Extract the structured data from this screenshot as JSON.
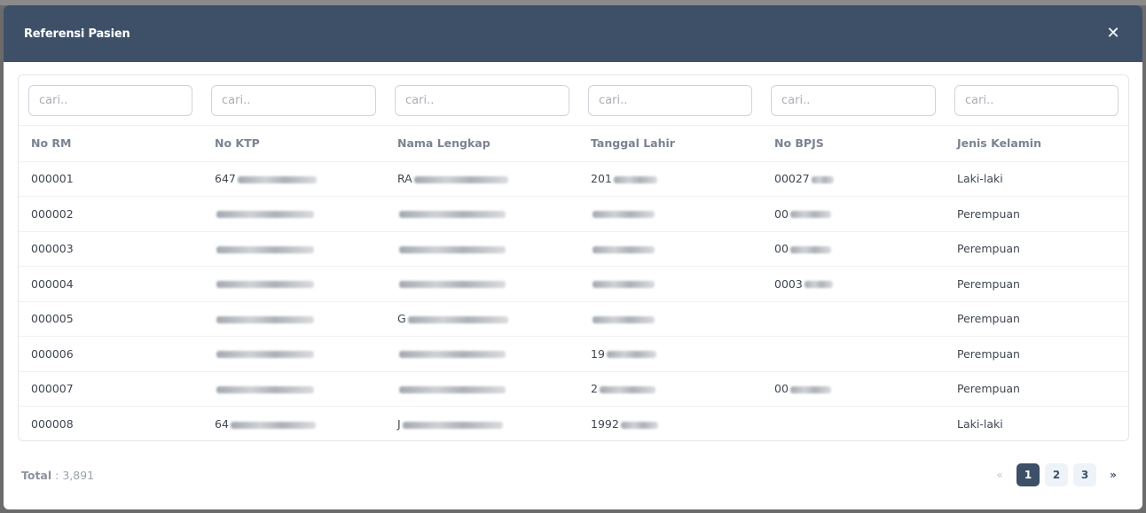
{
  "modal": {
    "title": "Referensi Pasien",
    "close_symbol": "✕"
  },
  "filters": [
    {
      "placeholder": "cari.."
    },
    {
      "placeholder": "cari.."
    },
    {
      "placeholder": "cari.."
    },
    {
      "placeholder": "cari.."
    },
    {
      "placeholder": "cari.."
    },
    {
      "placeholder": "cari.."
    }
  ],
  "table": {
    "columns": [
      "No RM",
      "No KTP",
      "Nama Lengkap",
      "Tanggal Lahir",
      "No BPJS",
      "Jenis Kelamin"
    ],
    "rows": [
      {
        "no_rm": "000001",
        "no_ktp": "647",
        "nama": "RA",
        "tgl": "201",
        "bpjs": "00027",
        "jk": "Laki-laki"
      },
      {
        "no_rm": "000002",
        "no_ktp": "",
        "nama": "",
        "tgl": "",
        "bpjs": "00",
        "jk": "Perempuan"
      },
      {
        "no_rm": "000003",
        "no_ktp": "",
        "nama": "",
        "tgl": "",
        "bpjs": "00",
        "jk": "Perempuan"
      },
      {
        "no_rm": "000004",
        "no_ktp": "",
        "nama": "",
        "tgl": "",
        "bpjs": "0003",
        "jk": "Perempuan"
      },
      {
        "no_rm": "000005",
        "no_ktp": "",
        "nama": "G",
        "tgl": "",
        "bpjs": "",
        "jk": "Perempuan"
      },
      {
        "no_rm": "000006",
        "no_ktp": "",
        "nama": "",
        "tgl": "19",
        "bpjs": "",
        "jk": "Perempuan"
      },
      {
        "no_rm": "000007",
        "no_ktp": "",
        "nama": "",
        "tgl": "2",
        "bpjs": "00",
        "jk": "Perempuan"
      },
      {
        "no_rm": "000008",
        "no_ktp": "64",
        "nama": "J",
        "tgl": "1992",
        "bpjs": "",
        "jk": "Laki-laki"
      }
    ]
  },
  "footer": {
    "total_label": "Total",
    "total_value": ": 3,891"
  },
  "pagination": {
    "prev": "«",
    "pages": [
      "1",
      "2",
      "3"
    ],
    "next": "»",
    "current": "1"
  },
  "colors": {
    "header_bg": "#3d5068",
    "active_page": "#3d5068"
  }
}
